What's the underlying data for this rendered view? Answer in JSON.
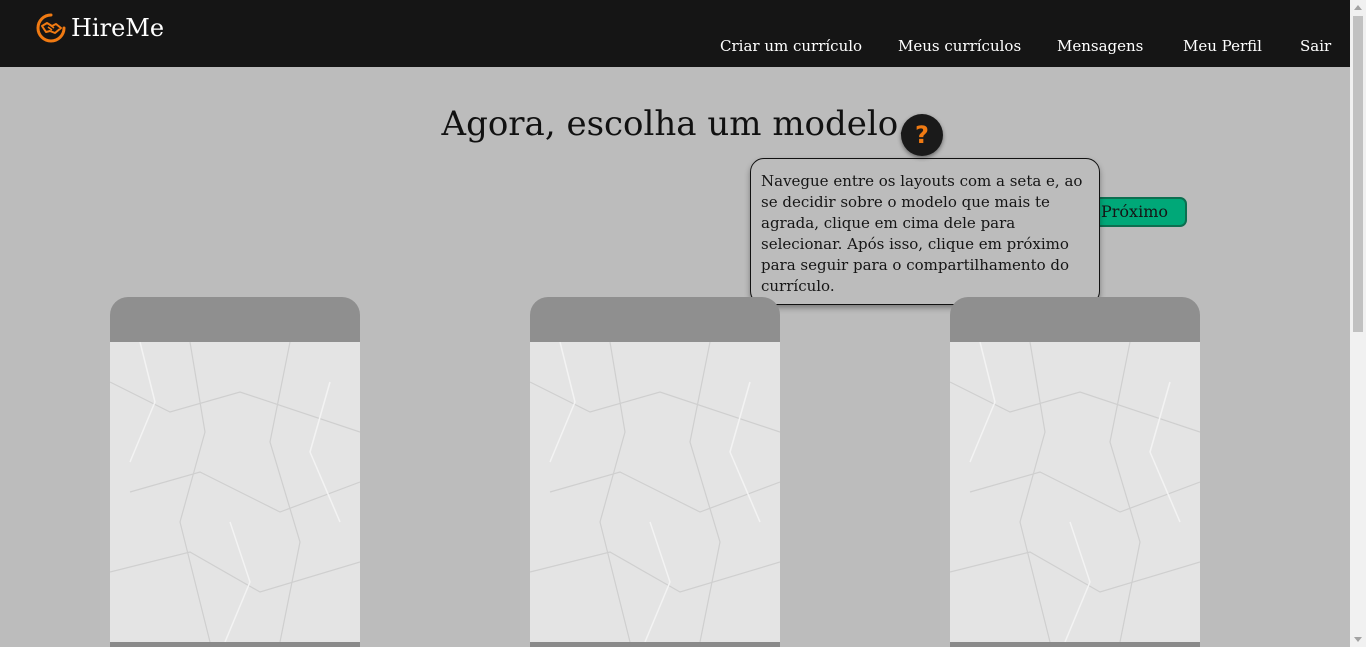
{
  "navbar": {
    "brand": "HireMe",
    "brand_icon": "handshake-icon",
    "accent": "#f07a12",
    "items": [
      {
        "label": "Criar um currículo"
      },
      {
        "label": "Meus currículos"
      },
      {
        "label": "Mensagens"
      },
      {
        "label": "Meu Perfil"
      },
      {
        "label": "Sair"
      }
    ]
  },
  "main": {
    "title": "Agora, escolha um modelo.",
    "help_icon": "question-mark-icon",
    "help_label": "?",
    "tooltip": "Navegue entre os layouts com a seta e, ao se decidir sobre o modelo que mais te agrada, clique em cima dele para selecionar. Após isso, clique em próximo para seguir para o compartilhamento do currículo.",
    "next_label": "Próximo",
    "next_color": "#00a878",
    "templates_count": 3
  }
}
